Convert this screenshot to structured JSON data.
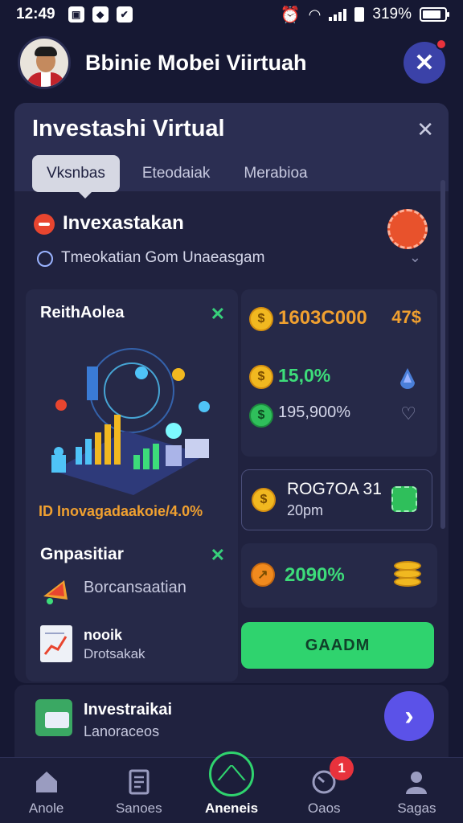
{
  "status_bar": {
    "time": "12:49",
    "battery": "319%",
    "app_icons": [
      "app-icon-1",
      "app-icon-2",
      "app-icon-3"
    ]
  },
  "header": {
    "title": "Bbinie Mobei Viirtuah",
    "close_icon": "close-icon"
  },
  "card": {
    "title": "Investashi Virtual",
    "close_icon": "close-icon",
    "tabs": [
      {
        "label": "Vksnbas",
        "active": true
      },
      {
        "label": "Eteodaiak",
        "active": false
      },
      {
        "label": "Merabioa",
        "active": false
      }
    ],
    "section": {
      "title": "Invexastakan",
      "subtitle": "Tmeokatian Gom Unaeasgam"
    },
    "left_panel": {
      "title": "ReithAolea",
      "stat": "ID Inovagadaakoie/4.0%",
      "title2": "Gnpasitiar",
      "item1": "Borcansaatian",
      "item2_title": "nooik",
      "item2_sub": "Drotsakak"
    },
    "stats": {
      "value1": "1603C000",
      "value1_suffix": "47$",
      "value2": "15,0%",
      "value3": "195,900%"
    },
    "record": {
      "title": "ROG7OA 31",
      "time": "20pm"
    },
    "percent": "2090%",
    "action_button": "GAADM"
  },
  "list_item": {
    "title": "Investraikai",
    "subtitle": "Lanoraceos"
  },
  "bottom_nav": [
    {
      "label": "Anole",
      "icon": "home-icon",
      "active": false
    },
    {
      "label": "Sanoes",
      "icon": "document-icon",
      "active": false
    },
    {
      "label": "Aneneis",
      "icon": "invest-icon",
      "active": true
    },
    {
      "label": "Oaos",
      "icon": "clock-icon",
      "active": false,
      "badge": "1"
    },
    {
      "label": "Sagas",
      "icon": "profile-icon",
      "active": false
    }
  ],
  "colors": {
    "background": "#161833",
    "card": "#20223f",
    "accent_green": "#2fd36e",
    "accent_orange": "#f0a030",
    "accent_purple": "#5b52e8"
  }
}
